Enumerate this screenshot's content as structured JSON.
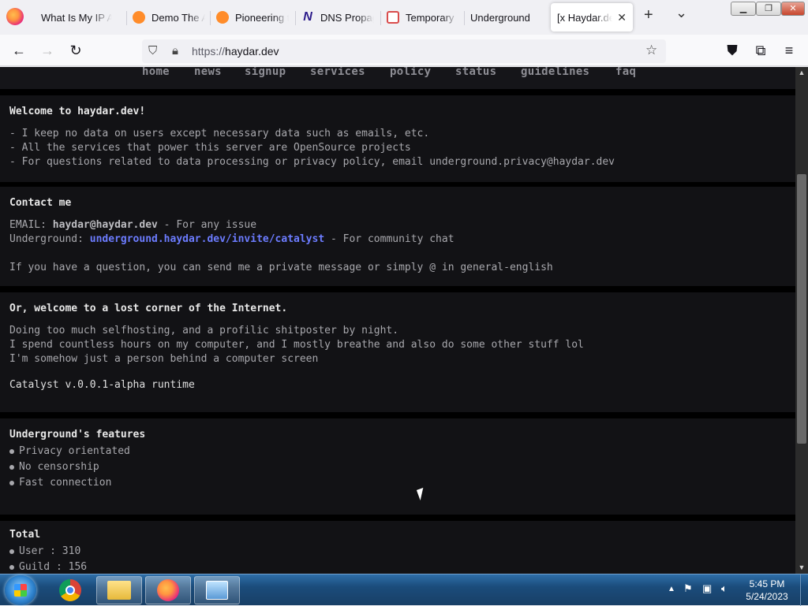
{
  "browser": {
    "tabs": [
      {
        "title": "What Is My IP A",
        "favicon_color": "#f0f0f4"
      },
      {
        "title": "Demo The A",
        "favicon_color": "#ff8c2a"
      },
      {
        "title": "Pioneering t",
        "favicon_color": "#ff8c2a"
      },
      {
        "title": "DNS Propag",
        "favicon_color": "#2b1a8a"
      },
      {
        "title": "Temporary E",
        "favicon_color": "#d94c4c"
      },
      {
        "title": "Underground",
        "favicon_color": ""
      },
      {
        "title": "[x Haydar.de",
        "favicon_color": "",
        "active": true
      }
    ],
    "url_scheme": "https://",
    "url_host": "haydar.dev",
    "new_tab_glyph": "+",
    "list_all_tabs_glyph": "⌄",
    "close_tab_glyph": "✕"
  },
  "site": {
    "nav": [
      "home",
      "news",
      "signup",
      "services",
      "policy",
      "status",
      "guidelines",
      "faq"
    ],
    "welcome": {
      "title": "Welcome to haydar.dev!",
      "lines": [
        "- I keep no data on users except necessary data such as emails, etc.",
        "- All the services that power this server are OpenSource projects",
        "- For questions related to data processing or privacy policy, email underground.privacy@haydar.dev"
      ]
    },
    "contact": {
      "title": "Contact me",
      "email_label": "EMAIL: ",
      "email_value": "haydar@haydar.dev",
      "email_note": " - For any issue",
      "underground_label": "Underground: ",
      "underground_link": "underground.haydar.dev/invite/catalyst",
      "underground_note": " - For community chat",
      "question": "If you have a question, you can send me a private message or simply @ in general-english"
    },
    "about": {
      "title": "Or, welcome to a lost corner of the Internet.",
      "lines": [
        "Doing too much selfhosting, and a profilic shitposter by night.",
        "I spend countless hours on my computer, and I mostly breathe and also do some other stuff lol",
        "I'm somehow just a person behind a computer screen"
      ],
      "runtime": "Catalyst v.0.0.1-alpha runtime"
    },
    "features": {
      "title": "Underground's features",
      "items": [
        "Privacy orientated",
        "No censorship",
        "Fast connection"
      ]
    },
    "total": {
      "title": "Total",
      "items": [
        "User : 310",
        "Guild : 156"
      ]
    }
  },
  "taskbar": {
    "clock_time": "5:45 PM",
    "clock_date": "5/24/2023"
  }
}
